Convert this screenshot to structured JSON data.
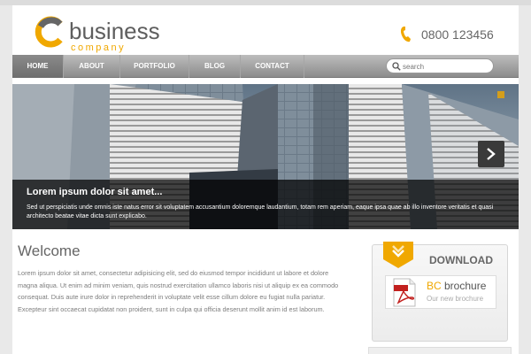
{
  "brand": {
    "name": "business",
    "tagline": "company"
  },
  "header": {
    "phone": "0800 123456"
  },
  "nav": {
    "items": [
      {
        "label": "HOME",
        "active": true
      },
      {
        "label": "ABOUT",
        "active": false
      },
      {
        "label": "PORTFOLIO",
        "active": false
      },
      {
        "label": "BLOG",
        "active": false
      },
      {
        "label": "CONTACT",
        "active": false
      }
    ],
    "search_placeholder": "search"
  },
  "hero": {
    "title": "Lorem ipsum dolor sit amet...",
    "text": "Sed ut perspiciatis unde omnis iste natus error sit voluptatem accusantium doloremque laudantium, totam rem aperiam, eaque ipsa quae ab illo inventore veritatis et quasi architecto beatae vitae dicta sunt explicabo."
  },
  "welcome": {
    "title": "Welcome",
    "text": "Lorem ipsum dolor sit amet, consectetur adipisicing elit, sed do eiusmod tempor incididunt ut labore et dolore magna aliqua. Ut enim ad minim veniam, quis nostrud exercitation ullamco laboris nisi ut aliquip ex ea commodo consequat. Duis aute irure dolor in reprehenderit in voluptate velit esse cillum dolore eu fugiat nulla pariatur. Excepteur sint occaecat cupidatat non proident, sunt in culpa qui officia deserunt mollit anim id est laborum."
  },
  "download": {
    "title": "DOWNLOAD",
    "brochure_highlight": "BC",
    "brochure_title": " brochure",
    "brochure_sub": "Our new brochure"
  },
  "colors": {
    "accent": "#f0a800",
    "nav": "#9a9a9a",
    "text": "#7d7d7d"
  },
  "icons": [
    "logo-c-icon",
    "phone-icon",
    "search-icon",
    "chevron-right-icon",
    "download-arrow-icon",
    "pdf-icon"
  ]
}
